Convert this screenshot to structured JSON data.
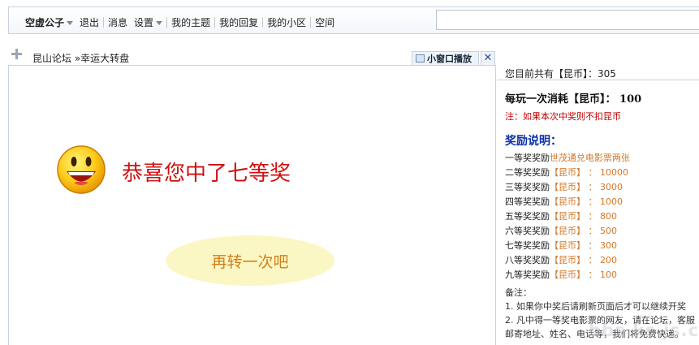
{
  "nav": {
    "user": "空虚公子",
    "logout": "退出",
    "messages": "消息",
    "settings": "设置",
    "my_topics": "我的主题",
    "my_replies": "我的回复",
    "my_community": "我的小区",
    "space": "空间"
  },
  "search": {
    "value": ""
  },
  "breadcrumb": {
    "text": "昆山论坛 »幸运大转盘"
  },
  "popup": {
    "label": "小窗口播放",
    "close": "✕"
  },
  "result": {
    "message": "恭喜您中了七等奖",
    "again_label": "再转一次吧"
  },
  "side": {
    "balance": "您目前共有【昆币】：305",
    "cost": "每玩一次消耗【昆币】： 100",
    "note": "注：如果本次中奖则不扣昆币",
    "reward_heading": "奖励说明：",
    "prizes": [
      {
        "level": "一等奖奖励",
        "reward": "世茂通兑电影票两张"
      },
      {
        "level": "二等奖奖励",
        "reward": "【昆币】 ： 10000"
      },
      {
        "level": "三等奖奖励",
        "reward": "【昆币】 ： 3000"
      },
      {
        "level": "四等奖奖励",
        "reward": "【昆币】 ： 1000"
      },
      {
        "level": "五等奖奖励",
        "reward": "【昆币】 ： 800"
      },
      {
        "level": "六等奖奖励",
        "reward": "【昆币】 ： 500"
      },
      {
        "level": "七等奖奖励",
        "reward": "【昆币】 ： 300"
      },
      {
        "level": "八等奖奖励",
        "reward": "【昆币】 ： 200"
      },
      {
        "level": "九等奖奖励",
        "reward": "【昆币】 ： 100"
      }
    ],
    "remarks": [
      "备注：",
      "1. 如果你中奖后请刷新页面后才可以继续开奖",
      "2. 凡中得一等奖电影票的网友，请在论坛，客服",
      "邮寄地址、姓名、电话等，我们将免费快递。"
    ]
  },
  "watermark": "bbs.ks.js.cn",
  "colors": {
    "accent_red": "#c00000",
    "heading_blue": "#0b2fa8",
    "reward_orange": "#d2772a"
  }
}
